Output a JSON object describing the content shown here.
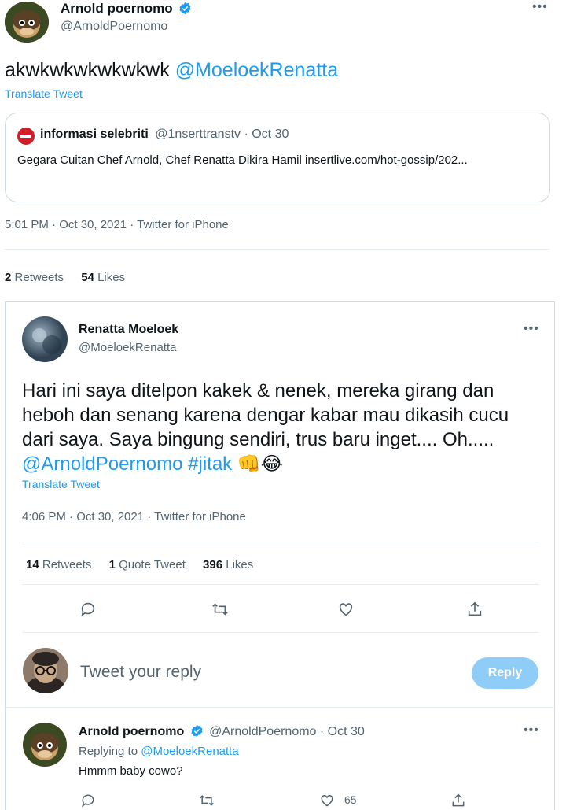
{
  "top_tweet": {
    "author_name": "Arnold poernomo",
    "handle": "@ArnoldPoernomo",
    "text_plain": "akwkwkwkwkwkwk",
    "text_mention": "@MoeloekRenatta",
    "translate": "Translate Tweet",
    "quoted": {
      "name": "informasi selebriti",
      "meta": "@1nserttranstv · Oct 30",
      "text": "Gegara Cuitan Chef Arnold, Chef Renatta Dikira Hamil insertlive.com/hot-gossip/202..."
    },
    "timestamp": "5:01 PM · Oct 30, 2021 · Twitter for iPhone",
    "retweets_count": "2",
    "retweets_label": "Retweets",
    "likes_count": "54",
    "likes_label": "Likes"
  },
  "embedded_tweet": {
    "author_name": "Renatta Moeloek",
    "handle": "@MoeloekRenatta",
    "text_plain": "Hari ini saya ditelpon kakek & nenek, mereka girang dan heboh dan senang karena dengar kabar mau dikasih cucu dari saya. Saya bingung sendiri, trus baru inget.... Oh..... ",
    "text_mention": "@ArnoldPoernomo",
    "text_hashtag": "#jitak",
    "text_emoji": "👊😂",
    "translate": "Translate Tweet",
    "timestamp": "4:06 PM · Oct 30, 2021 · Twitter for iPhone",
    "retweets_count": "14",
    "retweets_label": "Retweets",
    "quote_count": "1",
    "quote_label": "Quote Tweet",
    "likes_count": "396",
    "likes_label": "Likes",
    "reply_placeholder": "Tweet your reply",
    "reply_button": "Reply"
  },
  "reply_tweet": {
    "author_name": "Arnold poernomo",
    "meta": "@ArnoldPoernomo · Oct 30",
    "replying_prefix": "Replying to",
    "replying_to": "@MoeloekRenatta",
    "text": "Hmmm baby cowo?",
    "like_count": "65"
  },
  "colors": {
    "accent": "#1d9bf0",
    "muted": "#536471",
    "reply_button_bg": "#8ecdf8"
  },
  "icons": [
    "more-icon",
    "verified-icon",
    "reply-icon",
    "retweet-icon",
    "like-icon",
    "share-icon"
  ]
}
